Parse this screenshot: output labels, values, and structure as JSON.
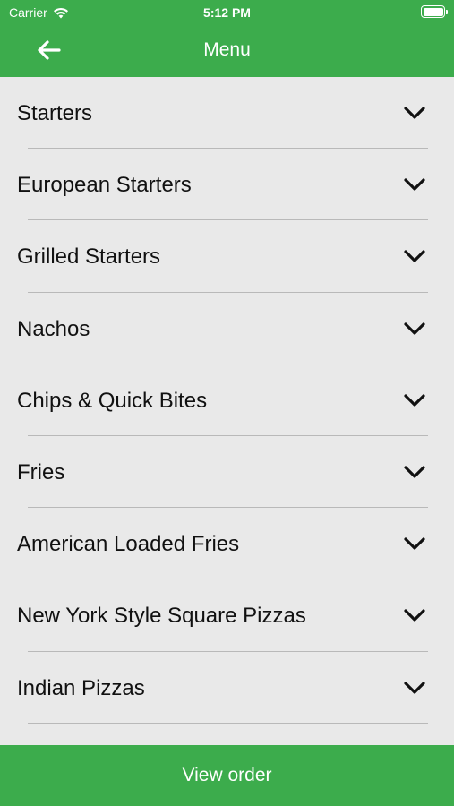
{
  "status_bar": {
    "carrier": "Carrier",
    "time": "5:12 PM"
  },
  "header": {
    "title": "Menu",
    "back_icon": "arrow-left-icon",
    "background": "#3cac4c"
  },
  "menu": {
    "categories": [
      {
        "label": "Starters"
      },
      {
        "label": "European Starters"
      },
      {
        "label": "Grilled Starters"
      },
      {
        "label": "Nachos"
      },
      {
        "label": "Chips & Quick Bites"
      },
      {
        "label": "Fries"
      },
      {
        "label": "American Loaded Fries"
      },
      {
        "label": "New York Style Square Pizzas"
      },
      {
        "label": "Indian Pizzas"
      }
    ],
    "expand_icon": "chevron-down-icon"
  },
  "footer": {
    "button_label": "View order"
  }
}
